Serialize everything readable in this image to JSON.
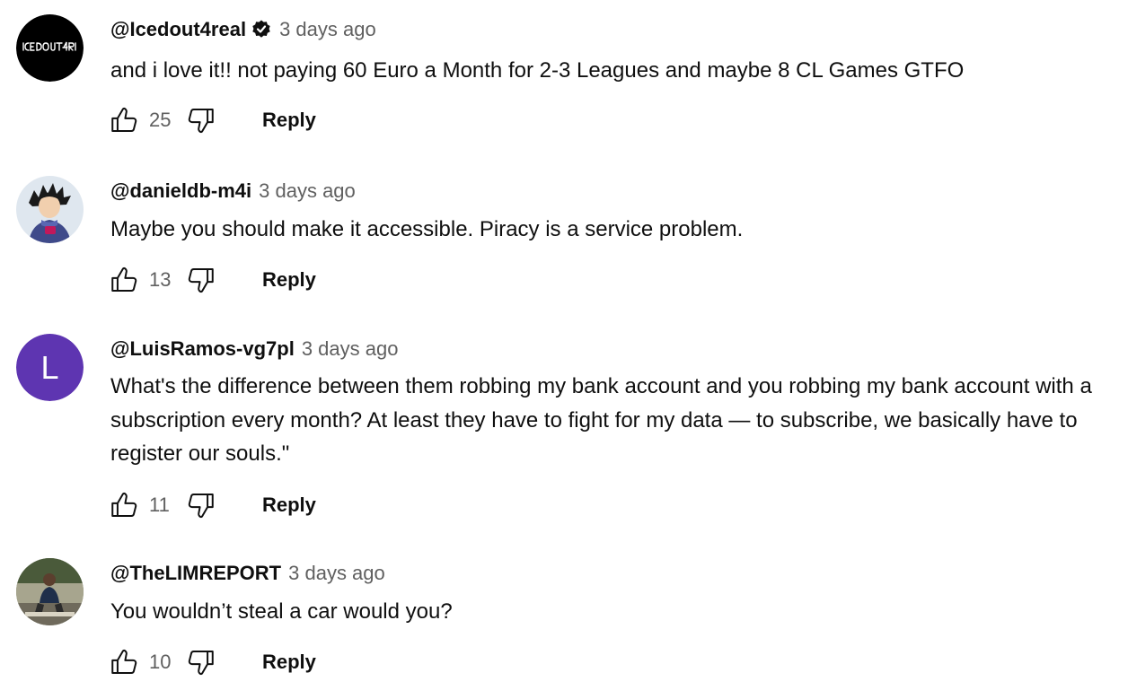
{
  "comments": [
    {
      "author": "@Icedout4real",
      "verified": true,
      "time": "3 days ago",
      "text": "and i love it!! not paying 60 Euro a Month for 2-3 Leagues and maybe 8 CL Games GTFO",
      "likes": "25",
      "reply_label": "Reply",
      "avatar": {
        "type": "logo",
        "logo_text": "ICEDOUT 4REAL",
        "bg": "#000000"
      }
    },
    {
      "author": "@danieldb-m4i",
      "verified": false,
      "time": "3 days ago",
      "text": "Maybe you should make it accessible. Piracy is a service problem.",
      "likes": "13",
      "reply_label": "Reply",
      "avatar": {
        "type": "illustration",
        "bg": "#dfe7ef"
      }
    },
    {
      "author": "@LuisRamos-vg7pl",
      "verified": false,
      "time": "3 days ago",
      "text": "What's the difference between them robbing my bank account and you robbing my bank account with a subscription every month? At least they have to fight for my data — to subscribe, we basically have to register our souls.\"",
      "likes": "11",
      "reply_label": "Reply",
      "avatar": {
        "type": "letter",
        "letter": "L",
        "bg": "#5e35b1"
      }
    },
    {
      "author": "@TheLIMREPORT",
      "verified": false,
      "time": "3 days ago",
      "text": "You wouldn’t steal a car would you?",
      "likes": "10",
      "reply_label": "Reply",
      "avatar": {
        "type": "photo",
        "bg": "#8a8f78"
      }
    }
  ],
  "icons": {
    "like": "thumbs-up-icon",
    "dislike": "thumbs-down-icon",
    "verified": "verified-badge-icon"
  },
  "colors": {
    "text_primary": "#0f0f0f",
    "text_secondary": "#606060",
    "background": "#ffffff"
  }
}
